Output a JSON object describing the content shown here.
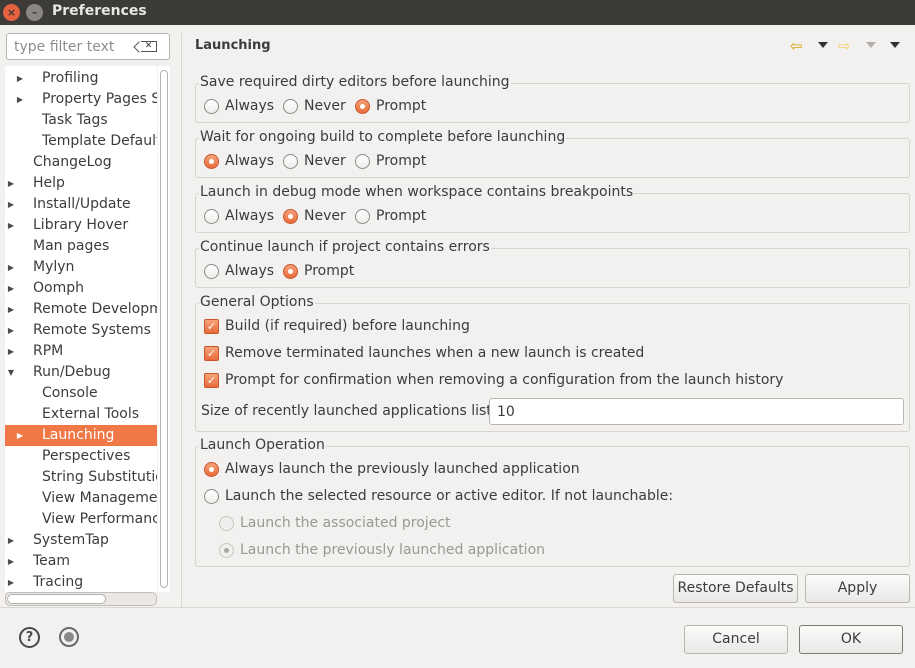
{
  "window": {
    "title": "Preferences"
  },
  "filter": {
    "placeholder": "type filter text"
  },
  "tree": [
    {
      "label": "Profiling",
      "indent": 1,
      "arrow": "▶"
    },
    {
      "label": "Property Pages Settings",
      "indent": 1,
      "arrow": "▶"
    },
    {
      "label": "Task Tags",
      "indent": 1,
      "arrow": ""
    },
    {
      "label": "Template Defaults",
      "indent": 1,
      "arrow": ""
    },
    {
      "label": "ChangeLog",
      "indent": 0,
      "arrow": ""
    },
    {
      "label": "Help",
      "indent": 0,
      "arrow": "▶"
    },
    {
      "label": "Install/Update",
      "indent": 0,
      "arrow": "▶"
    },
    {
      "label": "Library Hover",
      "indent": 0,
      "arrow": "▶"
    },
    {
      "label": "Man pages",
      "indent": 0,
      "arrow": ""
    },
    {
      "label": "Mylyn",
      "indent": 0,
      "arrow": "▶"
    },
    {
      "label": "Oomph",
      "indent": 0,
      "arrow": "▶"
    },
    {
      "label": "Remote Development",
      "indent": 0,
      "arrow": "▶"
    },
    {
      "label": "Remote Systems",
      "indent": 0,
      "arrow": "▶"
    },
    {
      "label": "RPM",
      "indent": 0,
      "arrow": "▶"
    },
    {
      "label": "Run/Debug",
      "indent": 0,
      "arrow": "▼"
    },
    {
      "label": "Console",
      "indent": 1,
      "arrow": ""
    },
    {
      "label": "External Tools",
      "indent": 1,
      "arrow": ""
    },
    {
      "label": "Launching",
      "indent": 1,
      "arrow": "▶",
      "selected": true
    },
    {
      "label": "Perspectives",
      "indent": 1,
      "arrow": ""
    },
    {
      "label": "String Substitution",
      "indent": 1,
      "arrow": ""
    },
    {
      "label": "View Management",
      "indent": 1,
      "arrow": ""
    },
    {
      "label": "View Performance",
      "indent": 1,
      "arrow": ""
    },
    {
      "label": "SystemTap",
      "indent": 0,
      "arrow": "▶"
    },
    {
      "label": "Team",
      "indent": 0,
      "arrow": "▶"
    },
    {
      "label": "Tracing",
      "indent": 0,
      "arrow": "▶"
    }
  ],
  "page": {
    "title": "Launching"
  },
  "groups": {
    "save_dirty": {
      "title": "Save required dirty editors before launching",
      "options": [
        "Always",
        "Never",
        "Prompt"
      ],
      "selected": "Prompt"
    },
    "wait_build": {
      "title": "Wait for ongoing build to complete before launching",
      "options": [
        "Always",
        "Never",
        "Prompt"
      ],
      "selected": "Always"
    },
    "debug_mode": {
      "title": "Launch in debug mode when workspace contains breakpoints",
      "options": [
        "Always",
        "Never",
        "Prompt"
      ],
      "selected": "Never"
    },
    "project_errors": {
      "title": "Continue launch if project contains errors",
      "options": [
        "Always",
        "Prompt"
      ],
      "selected": "Prompt"
    },
    "general": {
      "title": "General Options",
      "checks": [
        {
          "label": "Build (if required) before launching",
          "checked": true
        },
        {
          "label": "Remove terminated launches when a new launch is created",
          "checked": true
        },
        {
          "label": "Prompt for confirmation when removing a configuration from the launch history",
          "checked": true
        }
      ],
      "size_label": "Size of recently launched applications list:",
      "size_value": "10"
    },
    "launch_op": {
      "title": "Launch Operation",
      "opt1": "Always launch the previously launched application",
      "opt2": "Launch the selected resource or active editor. If not launchable:",
      "sub1": "Launch the associated project",
      "sub2": "Launch the previously launched application"
    }
  },
  "buttons": {
    "restore": "Restore Defaults",
    "apply": "Apply",
    "cancel": "Cancel",
    "ok": "OK"
  },
  "colors": {
    "accent": "#f07746",
    "titlebar": "#3c3b37"
  }
}
